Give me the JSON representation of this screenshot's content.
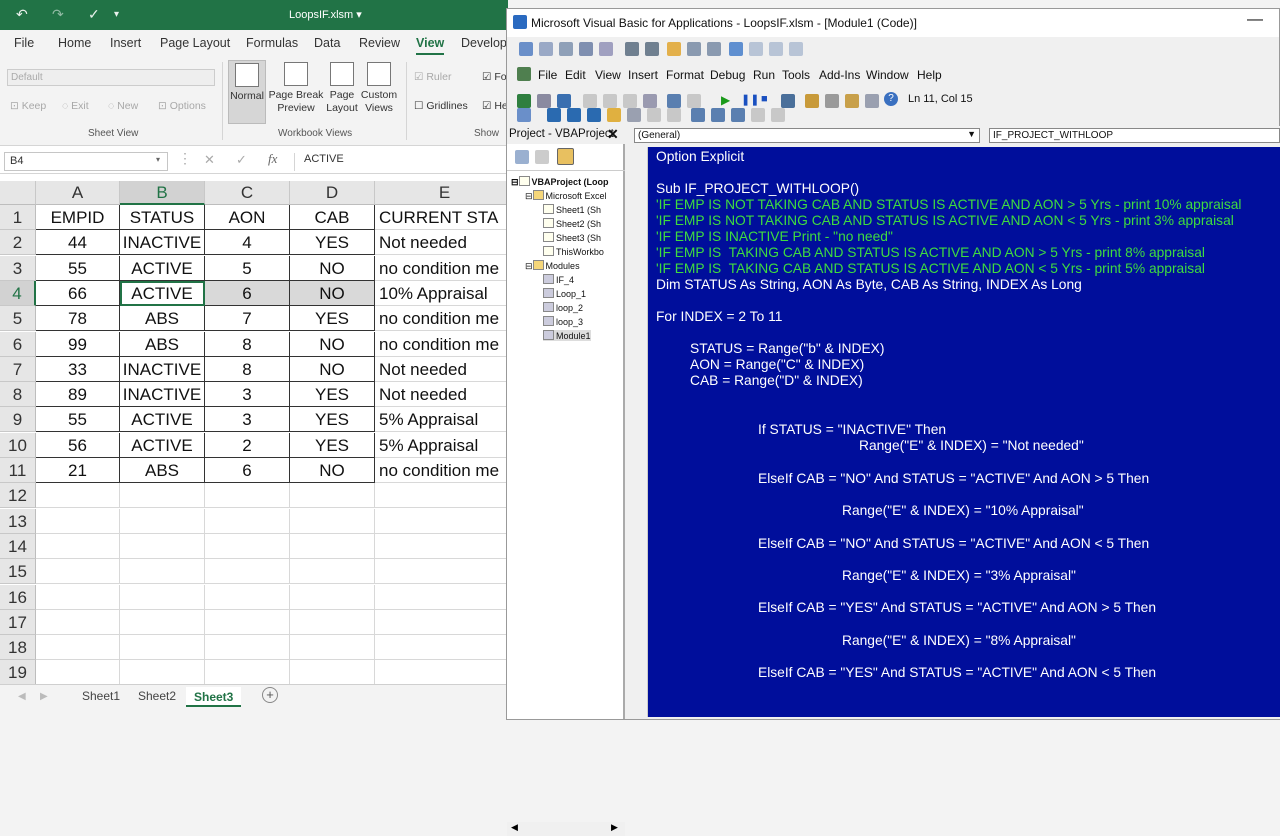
{
  "excel": {
    "title": "LoopsIF.xlsm",
    "title_suffix": "▾",
    "tabs": [
      "File",
      "Home",
      "Insert",
      "Page Layout",
      "Formulas",
      "Data",
      "Review",
      "View",
      "Develop"
    ],
    "active_tab": "View",
    "ribbon": {
      "sheet_view": {
        "dropdown": "Default",
        "keep": "Keep",
        "exit": "Exit",
        "new": "New",
        "options": "Options",
        "group": "Sheet View"
      },
      "workbook_views": {
        "normal": "Normal",
        "page_break": "Page Break",
        "page_break2": "Preview",
        "page_layout": "Page",
        "page_layout2": "Layout",
        "custom": "Custom",
        "custom2": "Views",
        "group": "Workbook Views"
      },
      "show": {
        "ruler": "Ruler",
        "gridlines": "Gridlines",
        "fo": "Fo",
        "he": "He",
        "group": "Show"
      }
    },
    "name_box": "B4",
    "formula_content": "ACTIVE",
    "fx": "fx",
    "columns": [
      "A",
      "B",
      "C",
      "D",
      "E"
    ],
    "rows": [
      [
        "EMPID",
        "STATUS",
        "AON",
        "CAB",
        "CURRENT STA"
      ],
      [
        "44",
        "INACTIVE",
        "4",
        "YES",
        "Not needed"
      ],
      [
        "55",
        "ACTIVE",
        "5",
        "NO",
        "no condition me"
      ],
      [
        "66",
        "ACTIVE",
        "6",
        "NO",
        "10% Appraisal"
      ],
      [
        "78",
        "ABS",
        "7",
        "YES",
        "no condition me"
      ],
      [
        "99",
        "ABS",
        "8",
        "NO",
        "no condition me"
      ],
      [
        "33",
        "INACTIVE",
        "8",
        "NO",
        "Not needed"
      ],
      [
        "89",
        "INACTIVE",
        "3",
        "YES",
        "Not needed"
      ],
      [
        "55",
        "ACTIVE",
        "3",
        "YES",
        "5% Appraisal"
      ],
      [
        "56",
        "ACTIVE",
        "2",
        "YES",
        "5% Appraisal"
      ],
      [
        "21",
        "ABS",
        "6",
        "NO",
        "no condition me"
      ],
      [
        "",
        "",
        "",
        "",
        ""
      ],
      [
        "",
        "",
        "",
        "",
        ""
      ],
      [
        "",
        "",
        "",
        "",
        ""
      ],
      [
        "",
        "",
        "",
        "",
        ""
      ],
      [
        "",
        "",
        "",
        "",
        ""
      ],
      [
        "",
        "",
        "",
        "",
        ""
      ],
      [
        "",
        "",
        "",
        "",
        ""
      ],
      [
        "",
        "",
        "",
        "",
        ""
      ]
    ],
    "row_numbers": [
      "1",
      "2",
      "3",
      "4",
      "5",
      "6",
      "7",
      "8",
      "9",
      "10",
      "11",
      "12",
      "13",
      "14",
      "15",
      "16",
      "17",
      "18",
      "19"
    ],
    "sheets": [
      "Sheet1",
      "Sheet2",
      "Sheet3"
    ],
    "active_sheet": "Sheet3"
  },
  "vba": {
    "title": "Microsoft Visual Basic for Applications - LoopsIF.xlsm - [Module1 (Code)]",
    "menu": [
      "File",
      "Edit",
      "View",
      "Insert",
      "Format",
      "Debug",
      "Run",
      "Tools",
      "Add-Ins",
      "Window",
      "Help"
    ],
    "position": "Ln 11, Col 15",
    "project_title": "Project - VBAProject",
    "tree": [
      "VBAProject (Loop",
      "Microsoft Excel",
      "Sheet1 (Sh",
      "Sheet2 (Sh",
      "Sheet3 (Sh",
      "ThisWorkbo",
      "Modules",
      "IF_4",
      "Loop_1",
      "loop_2",
      "loop_3",
      "Module1"
    ],
    "general_combo": "(General)",
    "proc_combo": "IF_PROJECT_WITHLOOP",
    "code": [
      {
        "t": "Option Explicit",
        "c": false
      },
      {
        "t": "Sub IF_PROJECT_WITHLOOP()",
        "c": false
      },
      {
        "t": "'IF EMP IS NOT TAKING CAB AND STATUS IS ACTIVE AND AON > 5 Yrs - print 10% appraisal",
        "c": true
      },
      {
        "t": "'IF EMP IS NOT TAKING CAB AND STATUS IS ACTIVE AND AON < 5 Yrs - print 3% appraisal",
        "c": true
      },
      {
        "t": "'IF EMP IS INACTIVE Print - \"no need\"",
        "c": true
      },
      {
        "t": "'IF EMP IS  TAKING CAB AND STATUS IS ACTIVE AND AON > 5 Yrs - print 8% appraisal",
        "c": true
      },
      {
        "t": "'IF EMP IS  TAKING CAB AND STATUS IS ACTIVE AND AON < 5 Yrs - print 5% appraisal",
        "c": true
      },
      {
        "t": "Dim STATUS As String, AON As Byte, CAB As String, INDEX As Long",
        "c": false
      },
      {
        "t": "For INDEX = 2 To 11",
        "c": false
      },
      {
        "t": "STATUS = Range(\"b\" & INDEX)",
        "c": false
      },
      {
        "t": "AON = Range(\"C\" & INDEX)",
        "c": false
      },
      {
        "t": "CAB = Range(\"D\" & INDEX)",
        "c": false
      },
      {
        "t": "If STATUS = \"INACTIVE\" Then",
        "c": false
      },
      {
        "t": "Range(\"E\" & INDEX) = \"Not needed\"",
        "c": false
      },
      {
        "t": "ElseIf CAB = \"NO\" And STATUS = \"ACTIVE\" And AON > 5 Then",
        "c": false
      },
      {
        "t": "Range(\"E\" & INDEX) = \"10% Appraisal\"",
        "c": false
      },
      {
        "t": "ElseIf CAB = \"NO\" And STATUS = \"ACTIVE\" And AON < 5 Then",
        "c": false
      },
      {
        "t": "Range(\"E\" & INDEX) = \"3% Appraisal\"",
        "c": false
      },
      {
        "t": "ElseIf CAB = \"YES\" And STATUS = \"ACTIVE\" And AON > 5 Then",
        "c": false
      },
      {
        "t": "Range(\"E\" & INDEX) = \"8% Appraisal\"",
        "c": false
      },
      {
        "t": "ElseIf CAB = \"YES\" And STATUS = \"ACTIVE\" And AON < 5 Then",
        "c": false
      }
    ]
  }
}
